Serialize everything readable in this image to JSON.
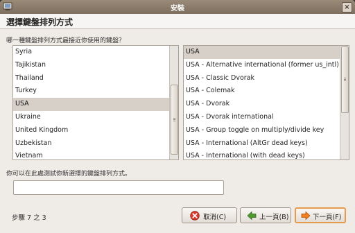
{
  "window": {
    "title": "安裝"
  },
  "header": {
    "title": "選擇鍵盤排列方式"
  },
  "question": "哪一種鍵盤排列方式最接近你使用的鍵盤？",
  "layouts": {
    "items": [
      "Syria",
      "Tajikistan",
      "Thailand",
      "Turkey",
      "USA",
      "Ukraine",
      "United Kingdom",
      "Uzbekistan",
      "Vietnam"
    ],
    "selected": "USA"
  },
  "variants": {
    "items": [
      "USA",
      "USA - Alternative international (former us_intl)",
      "USA - Classic Dvorak",
      "USA - Colemak",
      "USA - Dvorak",
      "USA - Dvorak international",
      "USA - Group toggle on multiply/divide key",
      "USA - International (AltGr dead keys)",
      "USA - International (with dead keys)"
    ],
    "selected": "USA"
  },
  "test": {
    "label": "你可以在此處測試你新選擇的鍵盤排列方式。",
    "value": ""
  },
  "footer": {
    "step": "步驟  7 之  3",
    "cancel": "取消(C)",
    "back": "上一頁(B)",
    "forward": "下一頁(F)"
  },
  "icons": {
    "window": "installer-icon",
    "close": "close-icon",
    "cancel": "cancel-icon",
    "back": "back-arrow-icon",
    "forward": "forward-arrow-icon"
  },
  "colors": {
    "selection": "#d6d0c8",
    "focus_ring": "#e59a4e",
    "titlebar": "#8a7b6a"
  }
}
